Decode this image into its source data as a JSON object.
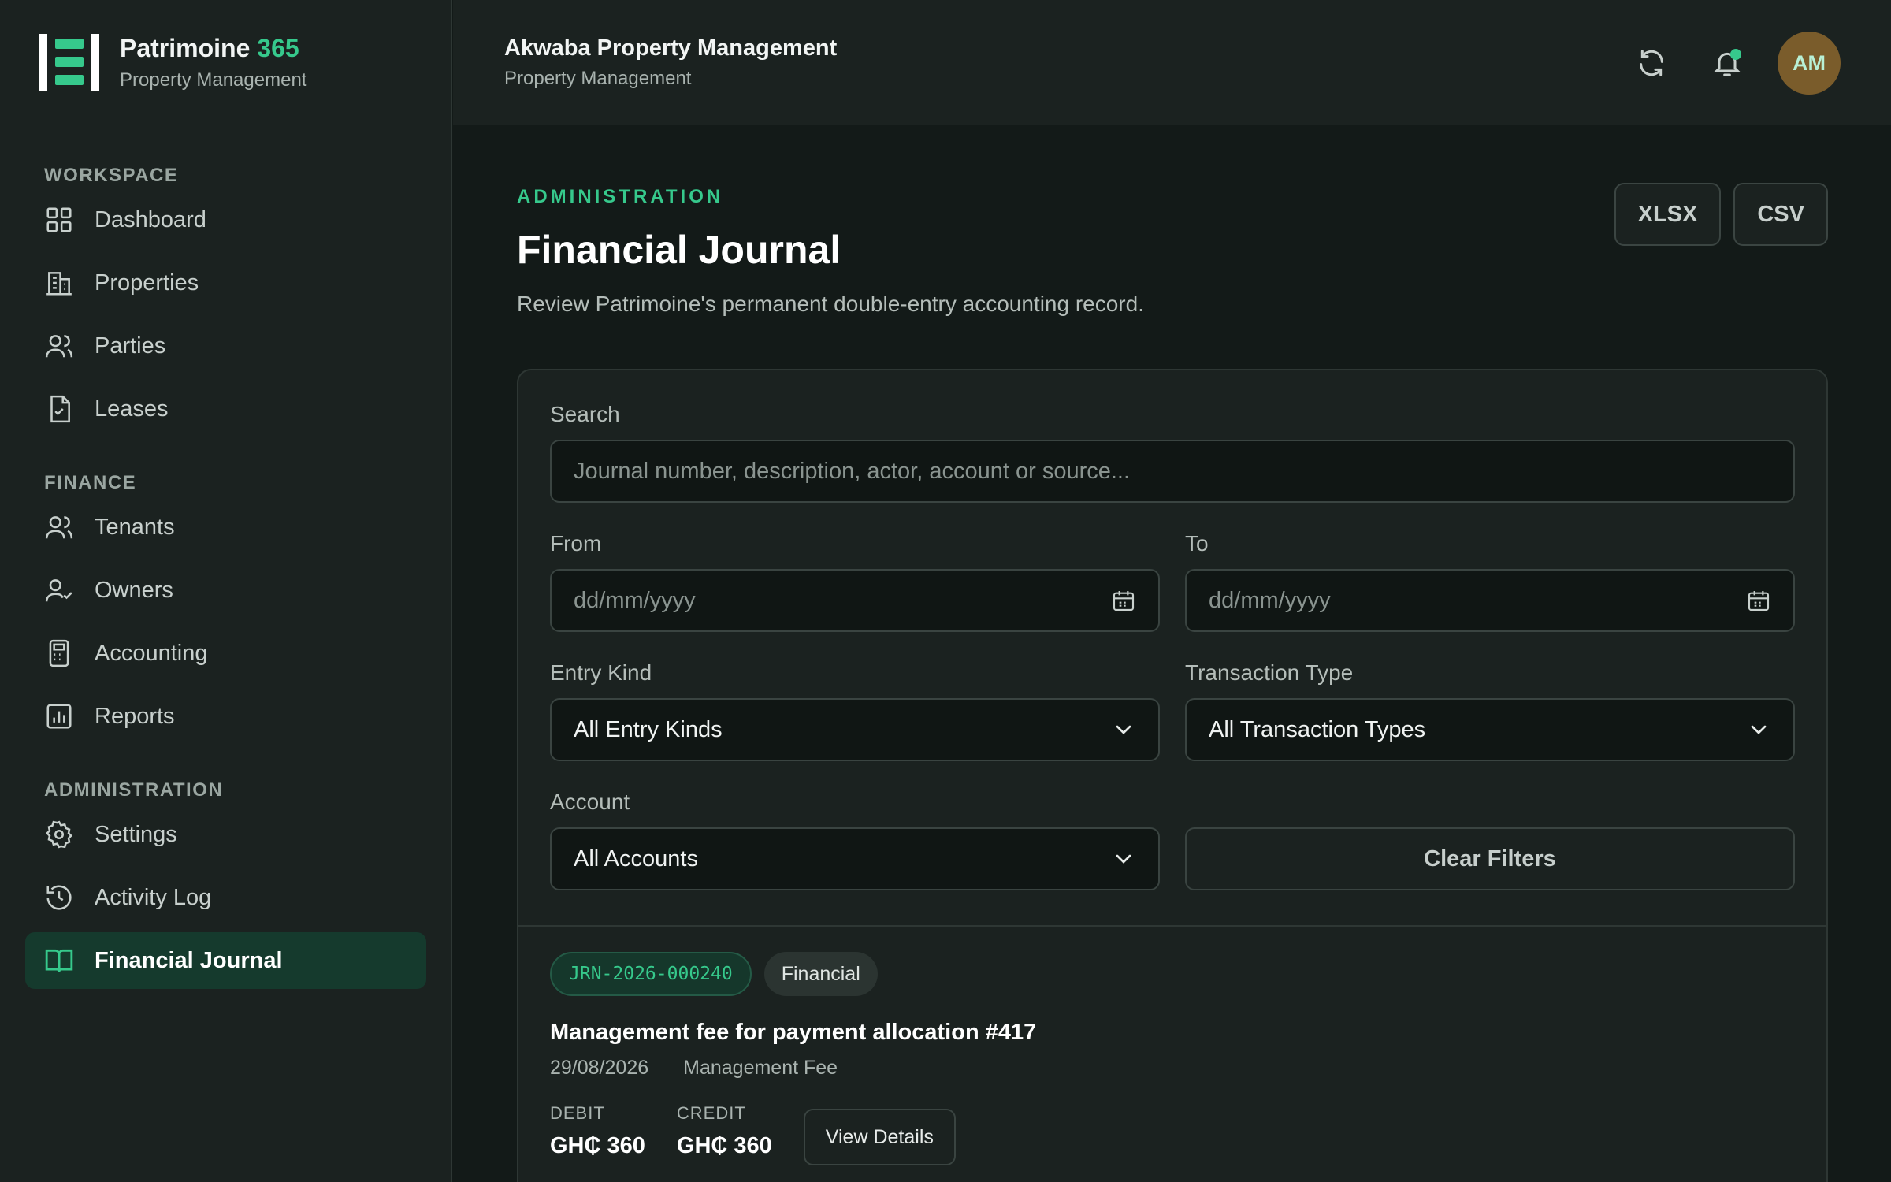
{
  "brand": {
    "name": "Patrimoine",
    "name_accent": "365",
    "subtitle": "Property Management"
  },
  "header": {
    "company": "Akwaba Property Management",
    "subtitle": "Property Management",
    "avatar_initials": "AM"
  },
  "sidebar": {
    "sections": [
      {
        "heading": "WORKSPACE",
        "items": [
          {
            "label": "Dashboard",
            "icon": "grid-icon"
          },
          {
            "label": "Properties",
            "icon": "building-icon"
          },
          {
            "label": "Parties",
            "icon": "users-icon"
          },
          {
            "label": "Leases",
            "icon": "document-check-icon"
          }
        ]
      },
      {
        "heading": "FINANCE",
        "items": [
          {
            "label": "Tenants",
            "icon": "users-icon"
          },
          {
            "label": "Owners",
            "icon": "user-check-icon"
          },
          {
            "label": "Accounting",
            "icon": "calculator-icon"
          },
          {
            "label": "Reports",
            "icon": "bar-chart-icon"
          }
        ]
      },
      {
        "heading": "ADMINISTRATION",
        "items": [
          {
            "label": "Settings",
            "icon": "gear-icon"
          },
          {
            "label": "Activity Log",
            "icon": "history-icon"
          },
          {
            "label": "Financial Journal",
            "icon": "book-icon",
            "active": true
          }
        ]
      }
    ]
  },
  "page": {
    "eyebrow": "ADMINISTRATION",
    "title": "Financial Journal",
    "description": "Review Patrimoine's permanent double-entry accounting record.",
    "export": {
      "xlsx": "XLSX",
      "csv": "CSV"
    }
  },
  "filters": {
    "search_label": "Search",
    "search_placeholder": "Journal number, description, actor, account or source...",
    "from_label": "From",
    "from_placeholder": "dd/mm/yyyy",
    "to_label": "To",
    "to_placeholder": "dd/mm/yyyy",
    "entry_kind_label": "Entry Kind",
    "entry_kind_value": "All Entry Kinds",
    "transaction_type_label": "Transaction Type",
    "transaction_type_value": "All Transaction Types",
    "account_label": "Account",
    "account_value": "All Accounts",
    "clear_label": "Clear Filters"
  },
  "entry": {
    "journal_number": "JRN-2026-000240",
    "kind": "Financial",
    "title": "Management fee for payment allocation #417",
    "date": "29/08/2026",
    "type": "Management Fee",
    "debit_label": "DEBIT",
    "debit_value": "GH₵ 360",
    "credit_label": "CREDIT",
    "credit_value": "GH₵ 360",
    "view_label": "View Details"
  },
  "colors": {
    "accent": "#36c98c",
    "background": "#131a18",
    "panel": "#1b2220",
    "avatar": "#7a5c2b"
  }
}
